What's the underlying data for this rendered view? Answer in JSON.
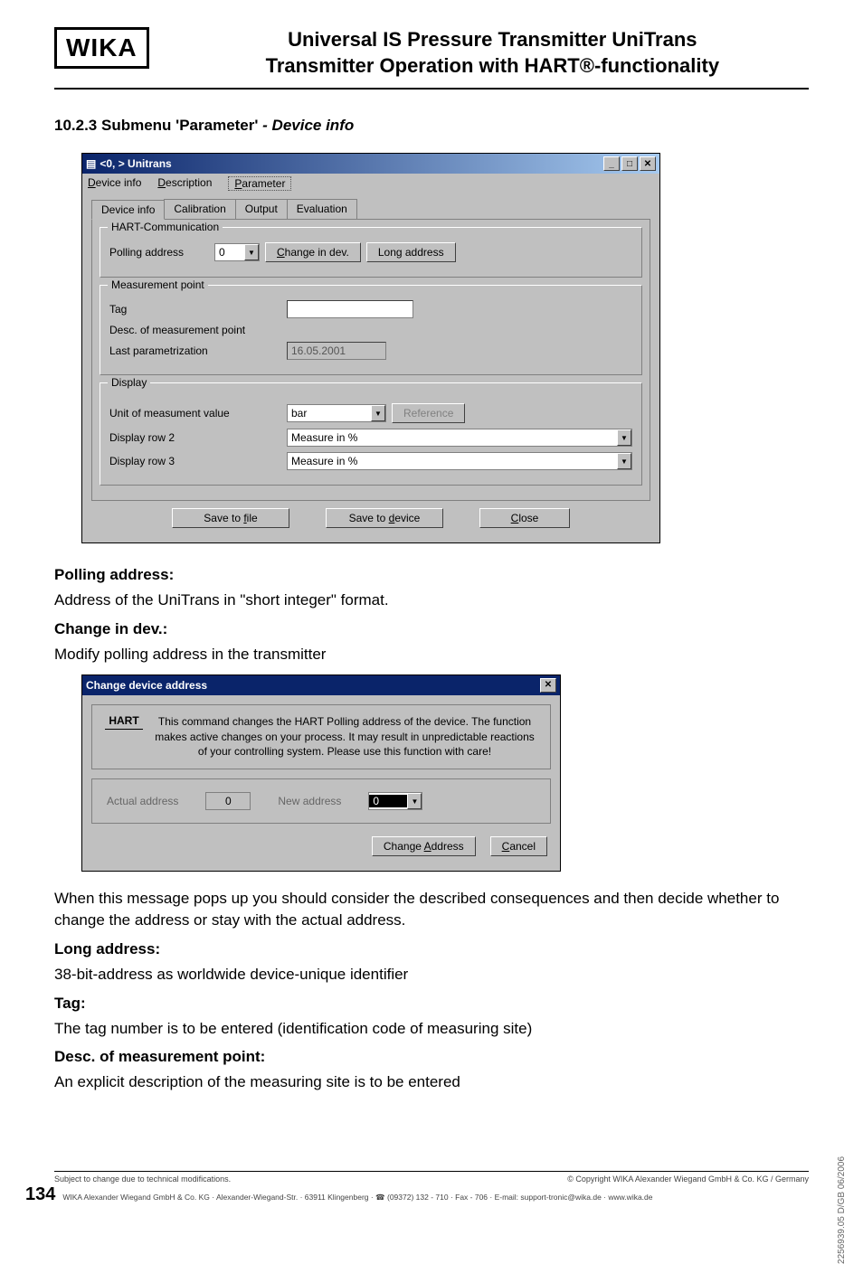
{
  "header": {
    "logo": "WIKA",
    "title_l1": "Universal IS Pressure Transmitter UniTrans",
    "title_l2": "Transmitter Operation with HART®-functionality"
  },
  "section_heading": {
    "num": "10.2.3",
    "plain": " Submenu 'Parameter' ",
    "italic": "- Device info"
  },
  "win1": {
    "title": "<0,      > Unitrans",
    "menu": {
      "device_info": "Device info",
      "description": "Description",
      "parameter": "Parameter"
    },
    "tabs": {
      "device_info": "Device info",
      "calibration": "Calibration",
      "output": "Output",
      "evaluation": "Evaluation"
    },
    "grp_hart": "HART-Communication",
    "lbl_polling": "Polling address",
    "val_polling": "0",
    "btn_change_dev": "Change in dev.",
    "btn_long_addr": "Long address",
    "grp_meas": "Measurement point",
    "lbl_tag": "Tag",
    "lbl_desc_mp": "Desc. of measurement point",
    "lbl_last_param": "Last parametrization",
    "val_last_param": "16.05.2001",
    "grp_display": "Display",
    "lbl_unit": "Unit of measument value",
    "val_unit": "bar",
    "btn_reference": "Reference",
    "lbl_row2": "Display row 2",
    "val_row2": "Measure in %",
    "lbl_row3": "Display row 3",
    "val_row3": "Measure in %",
    "btn_save_file": "Save to file",
    "btn_save_device": "Save to device",
    "btn_close": "Close"
  },
  "body": {
    "polling_h": "Polling address:",
    "polling_t": "Address of the UniTrans in \"short integer\" format.",
    "change_h": "Change in dev.:",
    "change_t": "Modify polling address in the transmitter",
    "dlg_title": "Change device address",
    "dlg_hart": "HART",
    "dlg_msg": "This command changes the HART Polling address of the device. The function makes active changes on your process. It may result in unpredictable reactions of your controlling system. Please use this function with care!",
    "dlg_actual": "Actual address",
    "dlg_actual_val": "0",
    "dlg_new": "New address",
    "dlg_new_val": "0",
    "dlg_btn_change": "Change Address",
    "dlg_btn_cancel": "Cancel",
    "after_dlg": "When this message pops up you should consider the described consequences and then decide whether to change the address or stay with the actual address.",
    "long_h": "Long address:",
    "long_t": "38-bit-address as worldwide device-unique identifier",
    "tag_h": "Tag:",
    "tag_t": "The tag number is to be entered (identification code of measuring site)",
    "desc_h": "Desc. of measurement point:",
    "desc_t": "An explicit description of the measuring site is to be entered"
  },
  "footer": {
    "vertical": "2256939.05 D/GB 06/2006",
    "left": "Subject to change due to technical modifications.",
    "right": "© Copyright WIKA Alexander Wiegand GmbH & Co. KG / Germany",
    "page_num": "134",
    "bottom": "WIKA Alexander Wiegand GmbH & Co. KG · Alexander-Wiegand-Str. · 63911 Klingenberg · ☎ (09372) 132 - 710 · Fax - 706 · E-mail: support-tronic@wika.de · www.wika.de"
  }
}
